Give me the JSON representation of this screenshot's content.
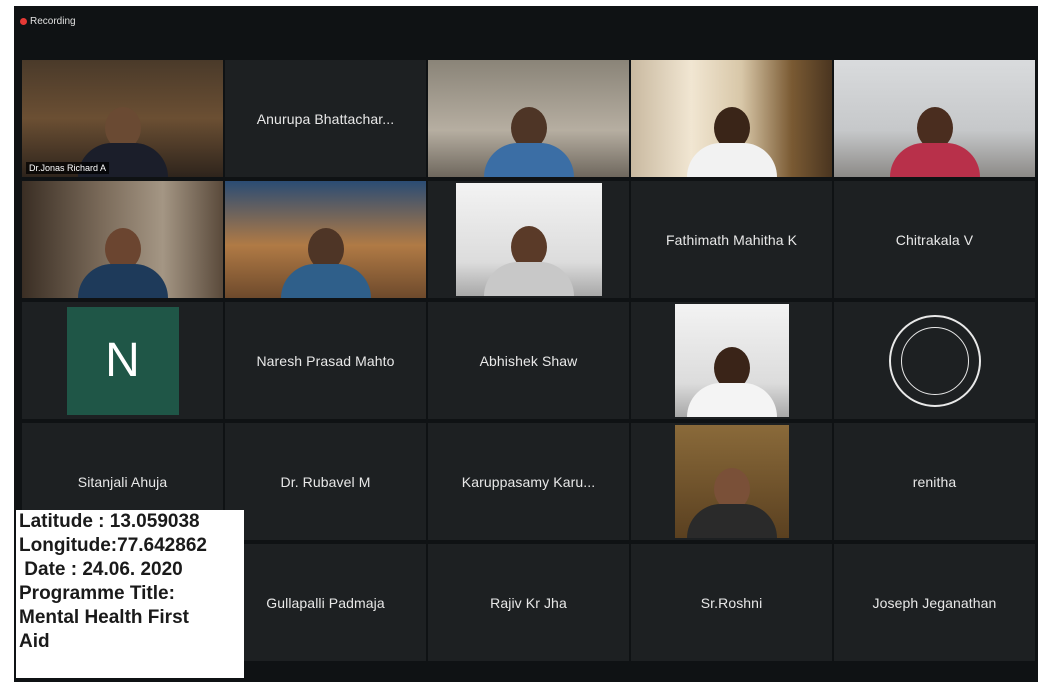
{
  "recording": {
    "label": "Recording",
    "dot_color": "#e53935"
  },
  "active_speaker_color": "#e8e05a",
  "participants": [
    {
      "name": "Dr.Jonas Richard A",
      "type": "video",
      "active": true,
      "video_label": "Dr.Jonas Richard A"
    },
    {
      "name": "Anurupa Bhattachar...",
      "type": "name"
    },
    {
      "type": "video"
    },
    {
      "type": "video"
    },
    {
      "type": "video"
    },
    {
      "type": "video"
    },
    {
      "type": "video"
    },
    {
      "type": "video"
    },
    {
      "name": "Fathimath Mahitha K",
      "type": "name"
    },
    {
      "name": "Chitrakala V",
      "type": "name"
    },
    {
      "type": "avatar",
      "initial": "N",
      "avatar_color": "#1f5647"
    },
    {
      "name": "Naresh Prasad Mahto",
      "type": "name"
    },
    {
      "name": "Abhishek Shaw",
      "type": "name"
    },
    {
      "type": "photo"
    },
    {
      "type": "logo",
      "icon": "institution-logo-icon"
    },
    {
      "name": "Sitanjali Ahuja",
      "type": "name"
    },
    {
      "name": "Dr. Rubavel M",
      "type": "name"
    },
    {
      "name": "Karuppasamy Karu...",
      "type": "name"
    },
    {
      "type": "photo"
    },
    {
      "name": "renitha",
      "type": "name"
    },
    {
      "type": "empty"
    },
    {
      "name": "Gullapalli Padmaja",
      "type": "name"
    },
    {
      "name": "Rajiv Kr Jha",
      "type": "name"
    },
    {
      "name": "Sr.Roshni",
      "type": "name"
    },
    {
      "name": "Joseph Jeganathan",
      "type": "name"
    }
  ],
  "geo_overlay": {
    "latitude": "Latitude : 13.059038",
    "longitude": "Longitude:77.642862",
    "date": " Date : 24.06. 2020",
    "programme_label": "Programme Title:",
    "programme_line1": "Mental Health First",
    "programme_line2": "Aid"
  }
}
